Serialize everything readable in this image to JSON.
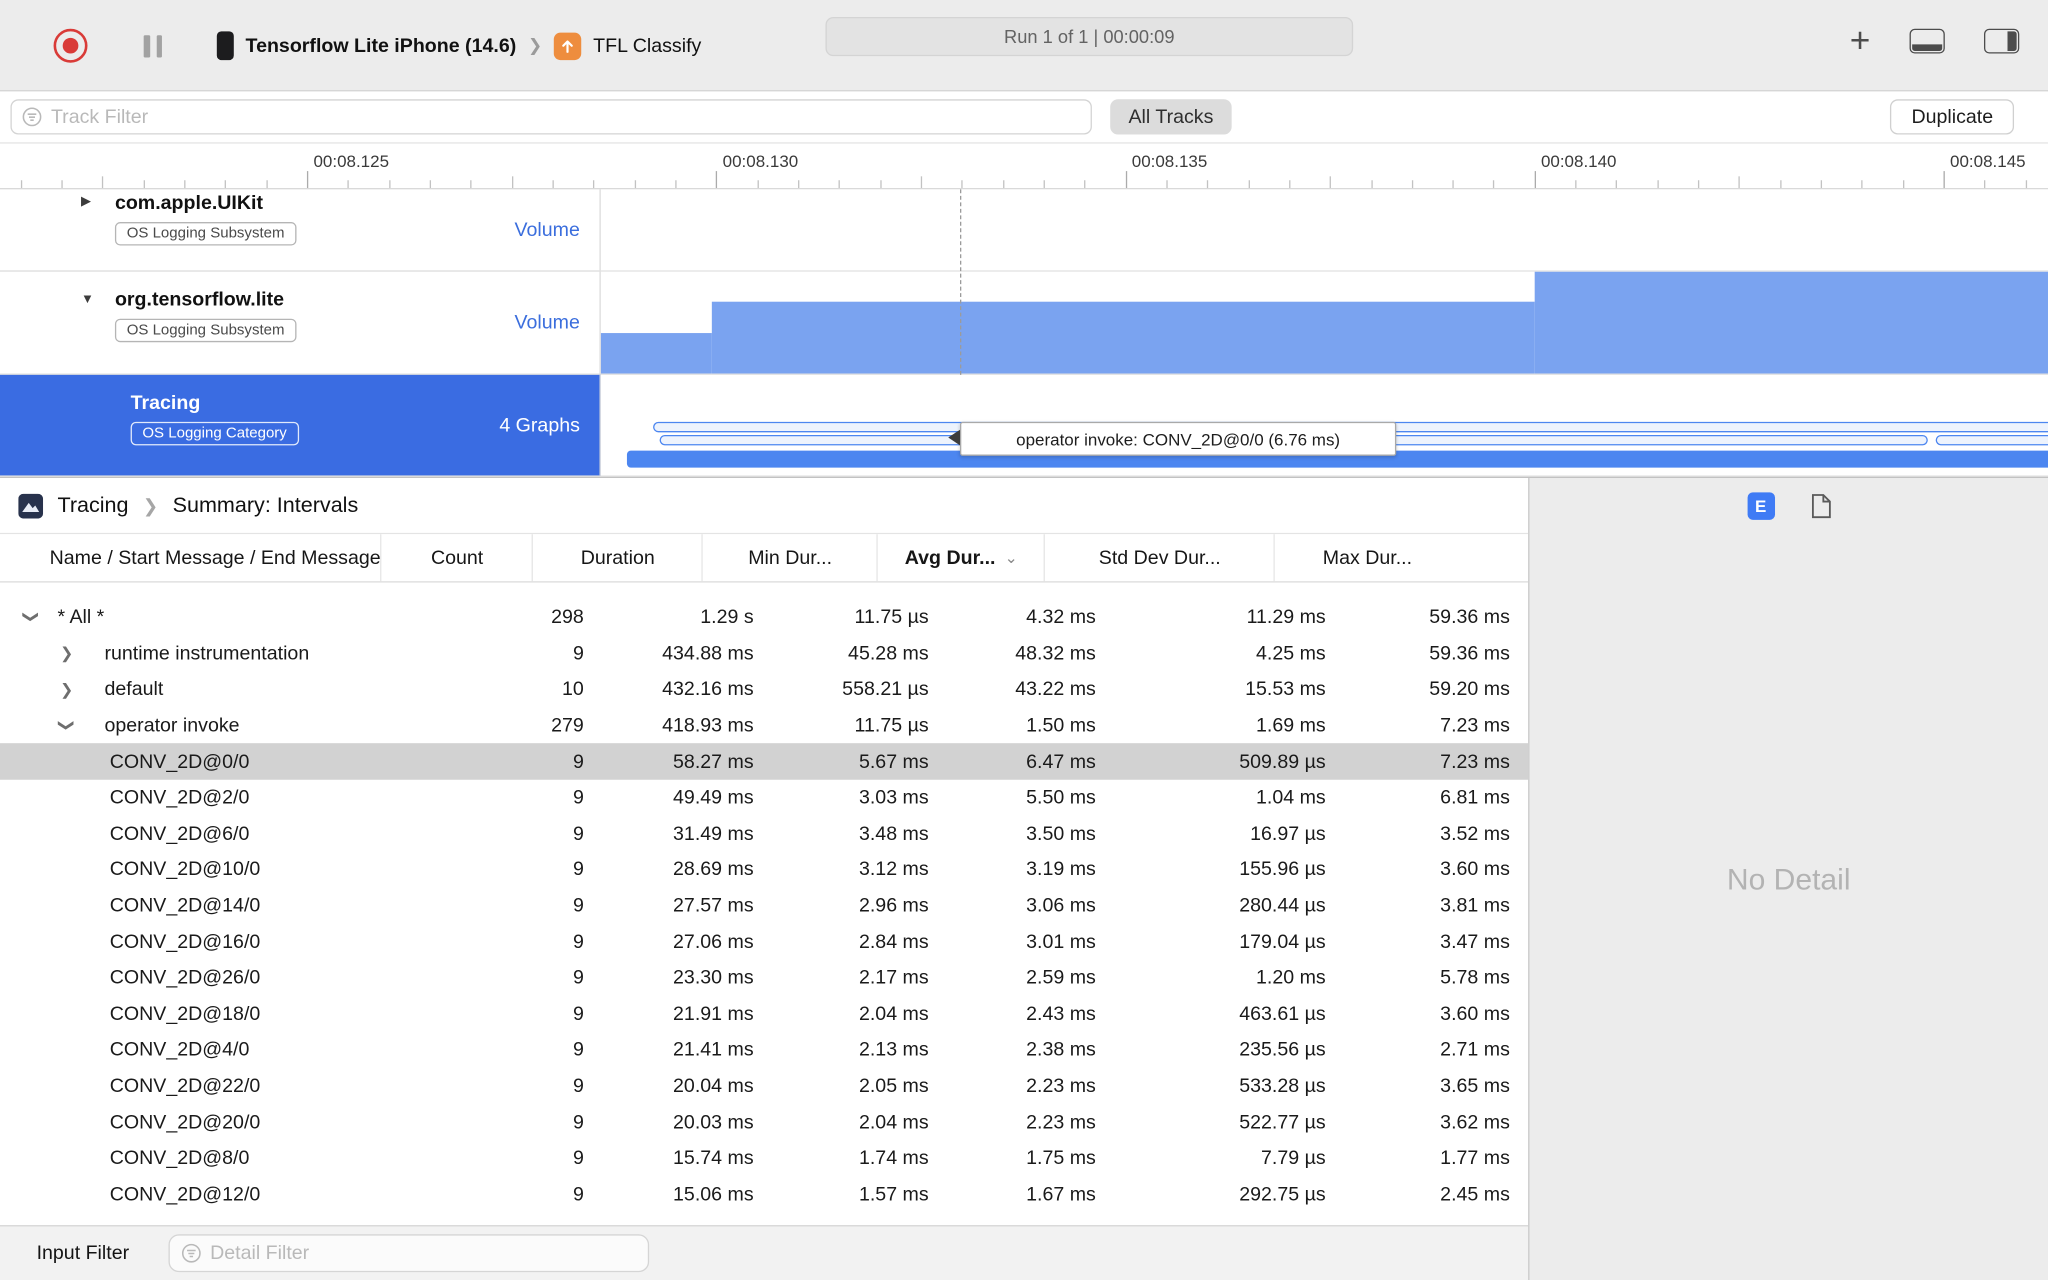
{
  "toolbar": {
    "device_name": "Tensorflow Lite iPhone (14.6)",
    "target_name": "TFL Classify",
    "run_status": "Run 1 of 1  |  00:00:09"
  },
  "filter_bar": {
    "track_filter_placeholder": "Track Filter",
    "all_tracks_label": "All Tracks",
    "duplicate_label": "Duplicate"
  },
  "ruler": {
    "ticks": [
      "00:08.125",
      "00:08.130",
      "00:08.135",
      "00:08.140",
      "00:08.145"
    ]
  },
  "tracks": [
    {
      "title": "com.apple.UIKit",
      "badge": "OS Logging Subsystem",
      "meta": "Volume",
      "disclosure": "collapsed",
      "selected": false
    },
    {
      "title": "org.tensorflow.lite",
      "badge": "OS Logging Subsystem",
      "meta": "Volume",
      "disclosure": "expanded",
      "selected": false,
      "volume_graph": {
        "color": "#7aa3f0",
        "segments": [
          {
            "start": 0.0,
            "end": 0.077,
            "level": 0.4
          },
          {
            "start": 0.077,
            "end": 0.645,
            "level": 0.7
          },
          {
            "start": 0.645,
            "end": 1.0,
            "level": 1.0
          }
        ]
      }
    },
    {
      "title": "Tracing",
      "badge": "OS Logging Category",
      "meta": "4 Graphs",
      "selected": true,
      "intervals": {
        "rows": [
          [
            {
              "start": 0.036,
              "end": 1.0
            }
          ],
          [
            {
              "start": 0.041,
              "end": 0.912
            },
            {
              "start": 0.922,
              "end": 1.0
            }
          ]
        ],
        "base_bar": {
          "start": 0.018,
          "end": 1.0
        }
      },
      "tooltip": "operator invoke: CONV_2D@0/0 (6.76 ms)"
    }
  ],
  "detail": {
    "breadcrumb": {
      "instrument": "Tracing",
      "page": "Summary: Intervals"
    },
    "extended_detail_button": "E",
    "no_detail_text": "No Detail",
    "input_filter_label": "Input Filter",
    "detail_filter_placeholder": "Detail Filter"
  },
  "table": {
    "columns": [
      {
        "label": "Name / Start Message / End Message",
        "sorted": false
      },
      {
        "label": "Count",
        "sorted": false
      },
      {
        "label": "Duration",
        "sorted": false
      },
      {
        "label": "Min Dur...",
        "sorted": false
      },
      {
        "label": "Avg Dur...",
        "sorted": true
      },
      {
        "label": "Std Dev Dur...",
        "sorted": false
      },
      {
        "label": "Max Dur...",
        "sorted": false
      }
    ],
    "rows": [
      {
        "level": 0,
        "disclosure": "expanded",
        "name": "* All *",
        "count": "298",
        "duration": "1.29 s",
        "min": "11.75 µs",
        "avg": "4.32 ms",
        "std": "11.29 ms",
        "max": "59.36 ms",
        "selected": false
      },
      {
        "level": 1,
        "disclosure": "collapsed",
        "name": "runtime instrumentation",
        "count": "9",
        "duration": "434.88 ms",
        "min": "45.28 ms",
        "avg": "48.32 ms",
        "std": "4.25 ms",
        "max": "59.36 ms",
        "selected": false
      },
      {
        "level": 1,
        "disclosure": "collapsed",
        "name": "default",
        "count": "10",
        "duration": "432.16 ms",
        "min": "558.21 µs",
        "avg": "43.22 ms",
        "std": "15.53 ms",
        "max": "59.20 ms",
        "selected": false
      },
      {
        "level": 1,
        "disclosure": "expanded",
        "name": "operator invoke",
        "count": "279",
        "duration": "418.93 ms",
        "min": "11.75 µs",
        "avg": "1.50 ms",
        "std": "1.69 ms",
        "max": "7.23 ms",
        "selected": false
      },
      {
        "level": 2,
        "disclosure": null,
        "name": "CONV_2D@0/0",
        "count": "9",
        "duration": "58.27 ms",
        "min": "5.67 ms",
        "avg": "6.47 ms",
        "std": "509.89 µs",
        "max": "7.23 ms",
        "selected": true
      },
      {
        "level": 2,
        "disclosure": null,
        "name": "CONV_2D@2/0",
        "count": "9",
        "duration": "49.49 ms",
        "min": "3.03 ms",
        "avg": "5.50 ms",
        "std": "1.04 ms",
        "max": "6.81 ms",
        "selected": false
      },
      {
        "level": 2,
        "disclosure": null,
        "name": "CONV_2D@6/0",
        "count": "9",
        "duration": "31.49 ms",
        "min": "3.48 ms",
        "avg": "3.50 ms",
        "std": "16.97 µs",
        "max": "3.52 ms",
        "selected": false
      },
      {
        "level": 2,
        "disclosure": null,
        "name": "CONV_2D@10/0",
        "count": "9",
        "duration": "28.69 ms",
        "min": "3.12 ms",
        "avg": "3.19 ms",
        "std": "155.96 µs",
        "max": "3.60 ms",
        "selected": false
      },
      {
        "level": 2,
        "disclosure": null,
        "name": "CONV_2D@14/0",
        "count": "9",
        "duration": "27.57 ms",
        "min": "2.96 ms",
        "avg": "3.06 ms",
        "std": "280.44 µs",
        "max": "3.81 ms",
        "selected": false
      },
      {
        "level": 2,
        "disclosure": null,
        "name": "CONV_2D@16/0",
        "count": "9",
        "duration": "27.06 ms",
        "min": "2.84 ms",
        "avg": "3.01 ms",
        "std": "179.04 µs",
        "max": "3.47 ms",
        "selected": false
      },
      {
        "level": 2,
        "disclosure": null,
        "name": "CONV_2D@26/0",
        "count": "9",
        "duration": "23.30 ms",
        "min": "2.17 ms",
        "avg": "2.59 ms",
        "std": "1.20 ms",
        "max": "5.78 ms",
        "selected": false
      },
      {
        "level": 2,
        "disclosure": null,
        "name": "CONV_2D@18/0",
        "count": "9",
        "duration": "21.91 ms",
        "min": "2.04 ms",
        "avg": "2.43 ms",
        "std": "463.61 µs",
        "max": "3.60 ms",
        "selected": false
      },
      {
        "level": 2,
        "disclosure": null,
        "name": "CONV_2D@4/0",
        "count": "9",
        "duration": "21.41 ms",
        "min": "2.13 ms",
        "avg": "2.38 ms",
        "std": "235.56 µs",
        "max": "2.71 ms",
        "selected": false
      },
      {
        "level": 2,
        "disclosure": null,
        "name": "CONV_2D@22/0",
        "count": "9",
        "duration": "20.04 ms",
        "min": "2.05 ms",
        "avg": "2.23 ms",
        "std": "533.28 µs",
        "max": "3.65 ms",
        "selected": false
      },
      {
        "level": 2,
        "disclosure": null,
        "name": "CONV_2D@20/0",
        "count": "9",
        "duration": "20.03 ms",
        "min": "2.04 ms",
        "avg": "2.23 ms",
        "std": "522.77 µs",
        "max": "3.62 ms",
        "selected": false
      },
      {
        "level": 2,
        "disclosure": null,
        "name": "CONV_2D@8/0",
        "count": "9",
        "duration": "15.74 ms",
        "min": "1.74 ms",
        "avg": "1.75 ms",
        "std": "7.79 µs",
        "max": "1.77 ms",
        "selected": false
      },
      {
        "level": 2,
        "disclosure": null,
        "name": "CONV_2D@12/0",
        "count": "9",
        "duration": "15.06 ms",
        "min": "1.57 ms",
        "avg": "1.67 ms",
        "std": "292.75 µs",
        "max": "2.45 ms",
        "selected": false
      }
    ]
  },
  "colors": {
    "selection_blue": "#3a6ce2",
    "chart_blue": "#7aa3f0",
    "capsule_blue": "#4c86f0",
    "volume_label_blue": "#3b6edd",
    "record_red": "#d93b38",
    "extended_detail_blue": "#3f7bf5",
    "selected_row_gray": "#d2d2d2"
  }
}
